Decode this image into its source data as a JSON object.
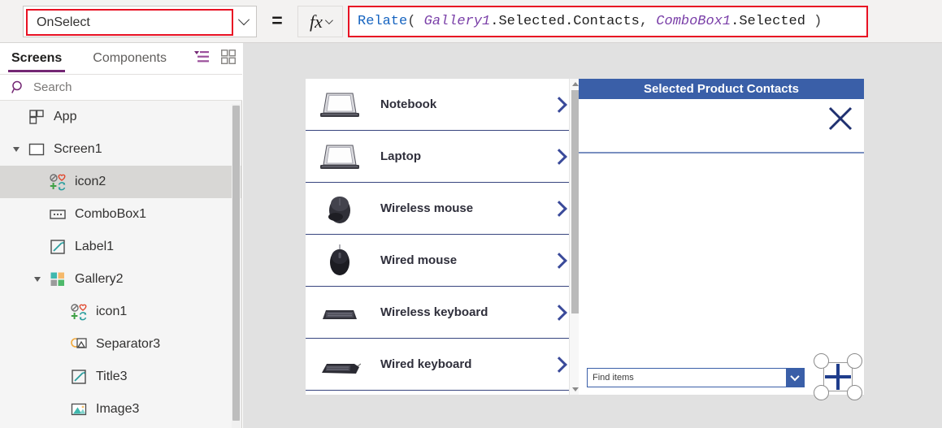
{
  "formula_bar": {
    "property_value": "OnSelect",
    "equals": "=",
    "fx_label": "fx",
    "formula_tokens": [
      {
        "t": "Relate",
        "k": "fn"
      },
      {
        "t": "( ",
        "k": "punc"
      },
      {
        "t": "Gallery1",
        "k": "obj"
      },
      {
        "t": ".Selected.Contacts",
        "k": "prop"
      },
      {
        "t": ", ",
        "k": "punc"
      },
      {
        "t": "ComboBox1",
        "k": "obj"
      },
      {
        "t": ".Selected",
        "k": "prop"
      },
      {
        "t": " )",
        "k": "punc"
      }
    ],
    "formula_plain": "Relate( Gallery1.Selected.Contacts, ComboBox1.Selected )"
  },
  "sidebar": {
    "tabs": [
      {
        "label": "Screens",
        "active": true
      },
      {
        "label": "Components",
        "active": false
      }
    ],
    "search": {
      "placeholder": "Search"
    },
    "tree": [
      {
        "label": "App",
        "indent": 0,
        "icon": "app-icon",
        "twisty": false,
        "selected": false
      },
      {
        "label": "Screen1",
        "indent": 0,
        "icon": "screen-icon",
        "twisty": true,
        "selected": false
      },
      {
        "label": "icon2",
        "indent": 1,
        "icon": "relate-icon",
        "twisty": false,
        "selected": true
      },
      {
        "label": "ComboBox1",
        "indent": 1,
        "icon": "combobox-icon",
        "twisty": false,
        "selected": false
      },
      {
        "label": "Label1",
        "indent": 1,
        "icon": "label-icon",
        "twisty": false,
        "selected": false
      },
      {
        "label": "Gallery2",
        "indent": 1,
        "icon": "gallery-icon",
        "twisty": true,
        "selected": false
      },
      {
        "label": "icon1",
        "indent": 2,
        "icon": "relate-icon",
        "twisty": false,
        "selected": false
      },
      {
        "label": "Separator3",
        "indent": 2,
        "icon": "separator-icon",
        "twisty": false,
        "selected": false
      },
      {
        "label": "Title3",
        "indent": 2,
        "icon": "label-icon",
        "twisty": false,
        "selected": false
      },
      {
        "label": "Image3",
        "indent": 2,
        "icon": "image-icon",
        "twisty": false,
        "selected": false
      }
    ]
  },
  "canvas": {
    "gallery": {
      "items": [
        {
          "name": "Notebook",
          "thumb": "laptop-open"
        },
        {
          "name": "Laptop",
          "thumb": "laptop-open"
        },
        {
          "name": "Wireless mouse",
          "thumb": "mouse-wireless"
        },
        {
          "name": "Wired mouse",
          "thumb": "mouse-wired"
        },
        {
          "name": "Wireless keyboard",
          "thumb": "keyboard-wireless"
        },
        {
          "name": "Wired keyboard",
          "thumb": "keyboard-wired"
        }
      ]
    },
    "panel": {
      "title": "Selected Product Contacts",
      "close_icon": "close-icon",
      "combobox": {
        "placeholder": "Find items"
      },
      "add_icon": "plus-icon"
    }
  },
  "colors": {
    "accent_purple": "#742774",
    "panel_blue": "#3a5fa8",
    "error_red": "#e81123",
    "chevron_blue": "#3a4a9a",
    "close_navy": "#1f3070",
    "canvas_bg": "#e1e1e1",
    "sidebar_bg": "#f5f5f5",
    "selected_row": "#d8d7d5"
  }
}
